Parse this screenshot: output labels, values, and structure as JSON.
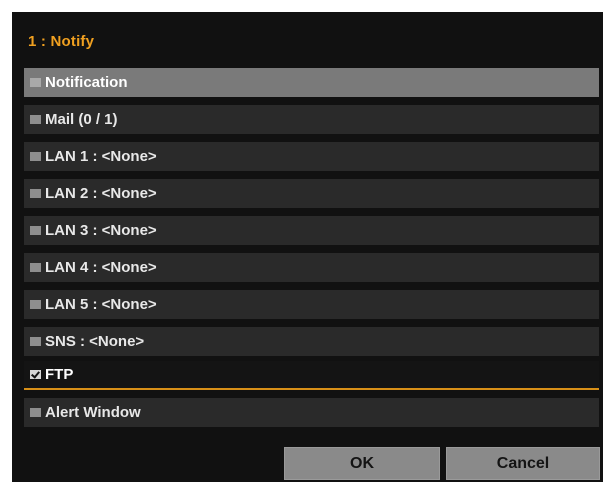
{
  "dialog": {
    "title": "1 : Notify"
  },
  "list": {
    "header": "Notification",
    "items": [
      {
        "label": "Mail (0 / 1)",
        "checked": false
      },
      {
        "label": "LAN 1 : <None>",
        "checked": false
      },
      {
        "label": "LAN 2 : <None>",
        "checked": false
      },
      {
        "label": "LAN 3 : <None>",
        "checked": false
      },
      {
        "label": "LAN 4 : <None>",
        "checked": false
      },
      {
        "label": "LAN 5 : <None>",
        "checked": false
      },
      {
        "label": "SNS : <None>",
        "checked": false
      },
      {
        "label": "FTP",
        "checked": true,
        "selected": true
      },
      {
        "label": "Alert Window",
        "checked": false
      }
    ]
  },
  "buttons": {
    "ok": "OK",
    "cancel": "Cancel"
  },
  "colors": {
    "background": "#111111",
    "title": "#f0a020",
    "row": "#2a2a2a",
    "header_row": "#7a7a7a",
    "selected_underline": "#d89018",
    "button": "#8a8a8a"
  }
}
